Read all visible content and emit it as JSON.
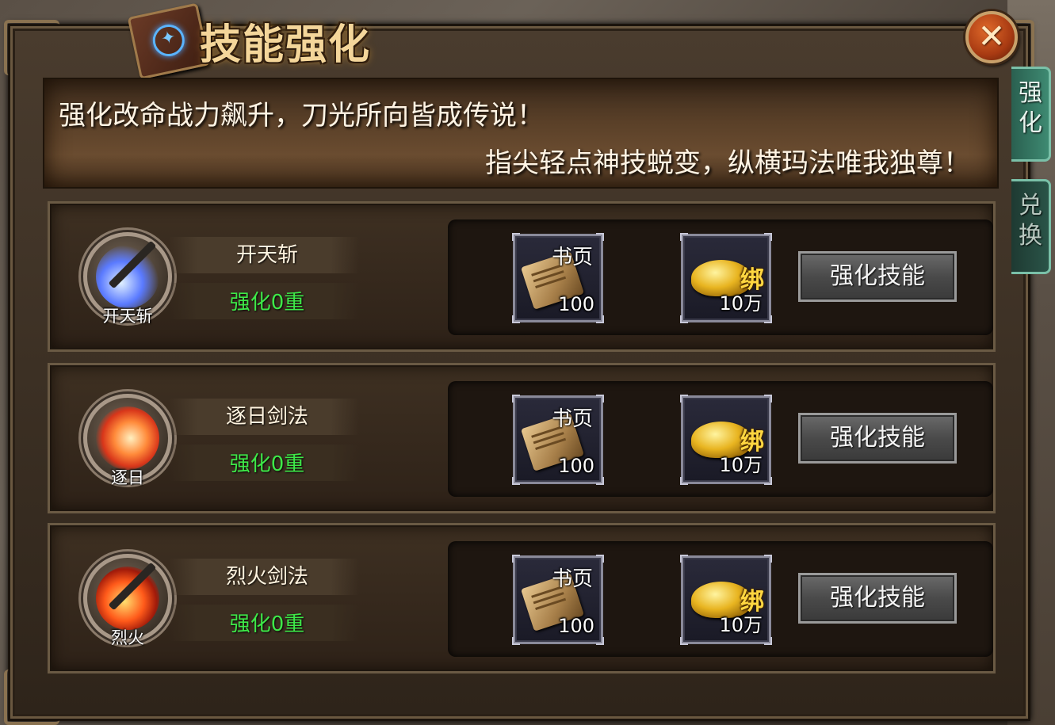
{
  "window": {
    "title": "技能强化",
    "close_label": "✕"
  },
  "side_tabs": [
    {
      "label": "强化",
      "active": true
    },
    {
      "label": "兑换",
      "active": false
    }
  ],
  "banner": {
    "line1": "强化改命战力飙升，刀光所向皆成传说！",
    "line2": "指尖轻点神技蜕变，纵横玛法唯我独尊！"
  },
  "skills": [
    {
      "name": "开天斩",
      "icon_label": "开天斩",
      "icon": "kaitianzhan-skill-icon",
      "level": "强化0重",
      "cost_item": {
        "label": "书页",
        "qty": "100"
      },
      "cost_gold": {
        "label": "绑",
        "qty": "10万"
      },
      "button": "强化技能"
    },
    {
      "name": "逐日剑法",
      "icon_label": "逐日",
      "icon": "zhuri-skill-icon",
      "level": "强化0重",
      "cost_item": {
        "label": "书页",
        "qty": "100"
      },
      "cost_gold": {
        "label": "绑",
        "qty": "10万"
      },
      "button": "强化技能"
    },
    {
      "name": "烈火剑法",
      "icon_label": "烈火",
      "icon": "liehuo-skill-icon",
      "level": "强化0重",
      "cost_item": {
        "label": "书页",
        "qty": "100"
      },
      "cost_gold": {
        "label": "绑",
        "qty": "10万"
      },
      "button": "强化技能"
    }
  ],
  "colors": {
    "level_text": "#3ee848",
    "title_gold": "#f4d69a",
    "bind_gold": "#ffd640"
  }
}
